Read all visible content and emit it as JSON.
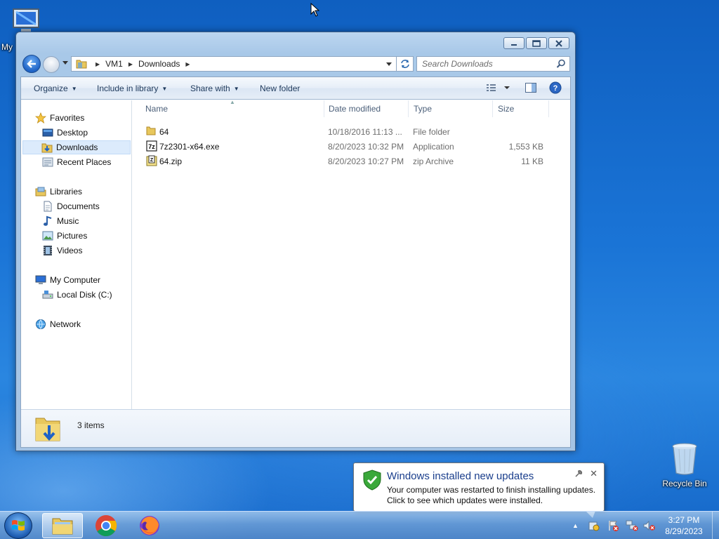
{
  "desktop": {
    "my_computer_label": "My",
    "recycle_bin_label": "Recycle Bin"
  },
  "window": {
    "address": {
      "crumbs": [
        "VM1",
        "Downloads"
      ]
    },
    "search": {
      "placeholder": "Search Downloads"
    },
    "toolbar": {
      "organize": "Organize",
      "include_in_library": "Include in library",
      "share_with": "Share with",
      "new_folder": "New folder"
    },
    "sidebar": {
      "favorites": "Favorites",
      "desktop": "Desktop",
      "downloads": "Downloads",
      "recent_places": "Recent Places",
      "libraries": "Libraries",
      "documents": "Documents",
      "music": "Music",
      "pictures": "Pictures",
      "videos": "Videos",
      "my_computer": "My Computer",
      "local_disk": "Local Disk (C:)",
      "network": "Network"
    },
    "columns": {
      "name": "Name",
      "date_modified": "Date modified",
      "type": "Type",
      "size": "Size"
    },
    "files": [
      {
        "name": "64",
        "date": "10/18/2016 11:13 ...",
        "type": "File folder",
        "size": "",
        "icon": "folder-icon"
      },
      {
        "name": "7z2301-x64.exe",
        "date": "8/20/2023 10:32 PM",
        "type": "Application",
        "size": "1,553 KB",
        "icon": "7zip-exe-icon"
      },
      {
        "name": "64.zip",
        "date": "8/20/2023 10:27 PM",
        "type": "zip Archive",
        "size": "11 KB",
        "icon": "zip-icon"
      }
    ],
    "details": {
      "count": "3 items"
    }
  },
  "notification": {
    "title": "Windows installed new updates",
    "line1": "Your computer was restarted to finish installing updates.",
    "line2": "Click to see which updates were installed."
  },
  "taskbar": {
    "time": "3:27 PM",
    "date": "8/29/2023"
  },
  "colors": {
    "accent": "#1a3e8c",
    "selection": "#dcebfc",
    "desktop": "#1a74d6"
  }
}
